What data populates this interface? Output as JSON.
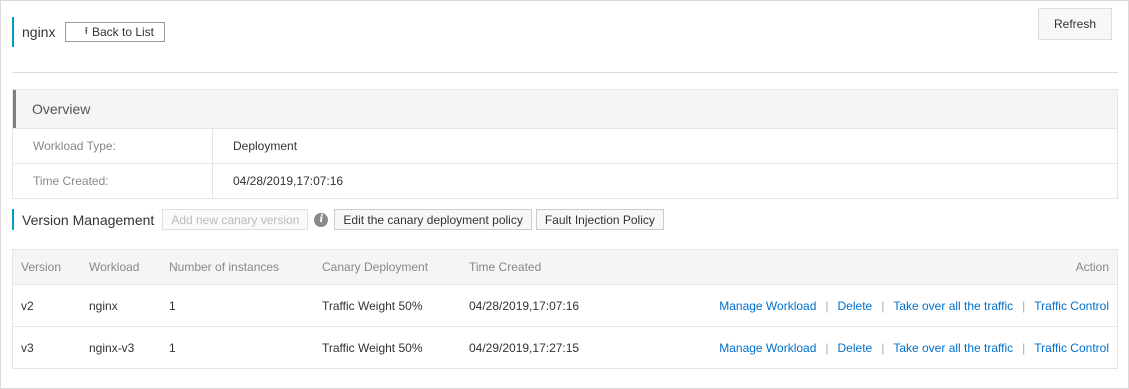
{
  "header": {
    "title": "nginx",
    "back_label": "Back to List",
    "refresh_label": "Refresh"
  },
  "overview": {
    "title": "Overview",
    "rows": [
      {
        "label": "Workload Type:",
        "value": "Deployment"
      },
      {
        "label": "Time Created:",
        "value": "04/28/2019,17:07:16"
      }
    ]
  },
  "version_management": {
    "title": "Version Management",
    "add_label": "Add new canary version",
    "edit_policy_label": "Edit the canary deployment policy",
    "fault_label": "Fault Injection Policy"
  },
  "table": {
    "columns": [
      "Version",
      "Workload",
      "Number of instances",
      "Canary Deployment",
      "Time Created",
      "Action"
    ],
    "rows": [
      {
        "version": "v2",
        "workload": "nginx",
        "instances": "1",
        "canary": "Traffic Weight 50%",
        "time": "04/28/2019,17:07:16"
      },
      {
        "version": "v3",
        "workload": "nginx-v3",
        "instances": "1",
        "canary": "Traffic Weight 50%",
        "time": "04/29/2019,17:27:15"
      }
    ],
    "actions": [
      "Manage Workload",
      "Delete",
      "Take over all the traffic",
      "Traffic Control"
    ],
    "separator": "|"
  },
  "colors": {
    "accent": "#00a2ca",
    "link": "#0070cc"
  }
}
